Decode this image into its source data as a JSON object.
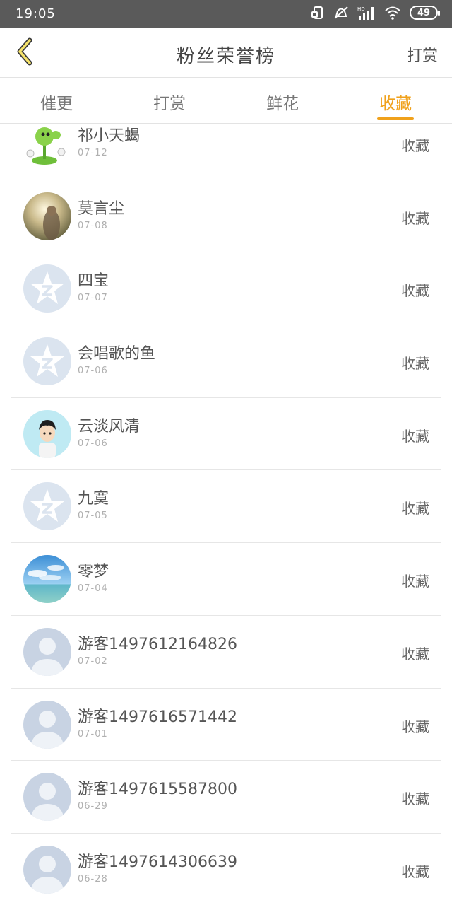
{
  "status_bar": {
    "time": "19:05",
    "battery": "49"
  },
  "header": {
    "back_icon": "chevron-left-icon",
    "title": "粉丝荣誉榜",
    "right_label": "打赏"
  },
  "tabs": [
    {
      "label": "催更",
      "active": false
    },
    {
      "label": "打赏",
      "active": false
    },
    {
      "label": "鲜花",
      "active": false
    },
    {
      "label": "收藏",
      "active": true
    }
  ],
  "colors": {
    "accent": "#f0a11b",
    "status_bar": "#5a5a5a",
    "divider": "#e6e6e6"
  },
  "list": [
    {
      "name": "祁小天蝎",
      "date": "07-12",
      "action": "收藏",
      "avatar": "peashooter-avatar"
    },
    {
      "name": "莫言尘",
      "date": "07-08",
      "action": "收藏",
      "avatar": "photo-avatar"
    },
    {
      "name": "四宝",
      "date": "07-07",
      "action": "收藏",
      "avatar": "qzone-star-avatar"
    },
    {
      "name": "会唱歌的鱼",
      "date": "07-06",
      "action": "收藏",
      "avatar": "qzone-star-avatar"
    },
    {
      "name": "云淡风清",
      "date": "07-06",
      "action": "收藏",
      "avatar": "cartoon-boy-avatar"
    },
    {
      "name": "九寞",
      "date": "07-05",
      "action": "收藏",
      "avatar": "qzone-star-avatar"
    },
    {
      "name": "零梦",
      "date": "07-04",
      "action": "收藏",
      "avatar": "sky-sea-avatar"
    },
    {
      "name": "游客1497612164826",
      "date": "07-02",
      "action": "收藏",
      "avatar": "default-user-avatar"
    },
    {
      "name": "游客1497616571442",
      "date": "07-01",
      "action": "收藏",
      "avatar": "default-user-avatar"
    },
    {
      "name": "游客1497615587800",
      "date": "06-29",
      "action": "收藏",
      "avatar": "default-user-avatar"
    },
    {
      "name": "游客1497614306639",
      "date": "06-28",
      "action": "收藏",
      "avatar": "default-user-avatar"
    }
  ]
}
